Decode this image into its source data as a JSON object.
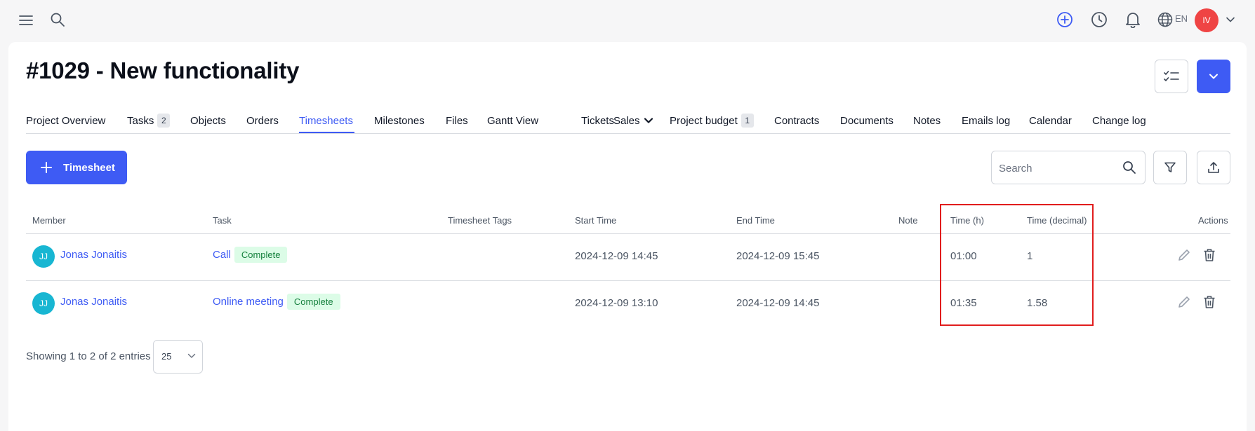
{
  "topbar": {
    "lang": "EN",
    "user_initials": "IV"
  },
  "page": {
    "title": "#1029 - New functionality"
  },
  "tabs": [
    {
      "label": "Project Overview"
    },
    {
      "label": "Tasks",
      "badge": "2"
    },
    {
      "label": "Objects"
    },
    {
      "label": "Orders"
    },
    {
      "label": "Timesheets",
      "active": true
    },
    {
      "label": "Milestones"
    },
    {
      "label": "Files"
    },
    {
      "label": "Gantt View"
    },
    {
      "label": "Tickets"
    },
    {
      "label": "Sales"
    },
    {
      "label": "Project budget",
      "badge": "1"
    },
    {
      "label": "Contracts"
    },
    {
      "label": "Documents"
    },
    {
      "label": "Notes"
    },
    {
      "label": "Emails log"
    },
    {
      "label": "Calendar"
    },
    {
      "label": "Change log"
    }
  ],
  "toolbar": {
    "add_label": "Timesheet",
    "search_placeholder": "Search"
  },
  "table": {
    "headers": {
      "member": "Member",
      "task": "Task",
      "tags": "Timesheet Tags",
      "start": "Start Time",
      "end": "End Time",
      "note": "Note",
      "time_h": "Time (h)",
      "time_dec": "Time (decimal)",
      "actions": "Actions"
    },
    "rows": [
      {
        "initials": "JJ",
        "member": "Jonas Jonaitis",
        "task": "Call",
        "status": "Complete",
        "tags": "",
        "start": "2024-12-09 14:45",
        "end": "2024-12-09 15:45",
        "note": "",
        "time_h": "01:00",
        "time_dec": "1"
      },
      {
        "initials": "JJ",
        "member": "Jonas Jonaitis",
        "task": "Online meeting",
        "status": "Complete",
        "tags": "",
        "start": "2024-12-09 13:10",
        "end": "2024-12-09 14:45",
        "note": "",
        "time_h": "01:35",
        "time_dec": "1.58"
      }
    ]
  },
  "footer": {
    "showing": "Showing 1 to 2 of 2 entries",
    "page_size": "25"
  },
  "colors": {
    "accent": "#3e5bf4",
    "highlight": "#e11d1d",
    "status_bg": "#dcfce7",
    "status_text": "#15803d",
    "avatar_user": "#ef4444",
    "avatar_member": "#18b6d2"
  }
}
